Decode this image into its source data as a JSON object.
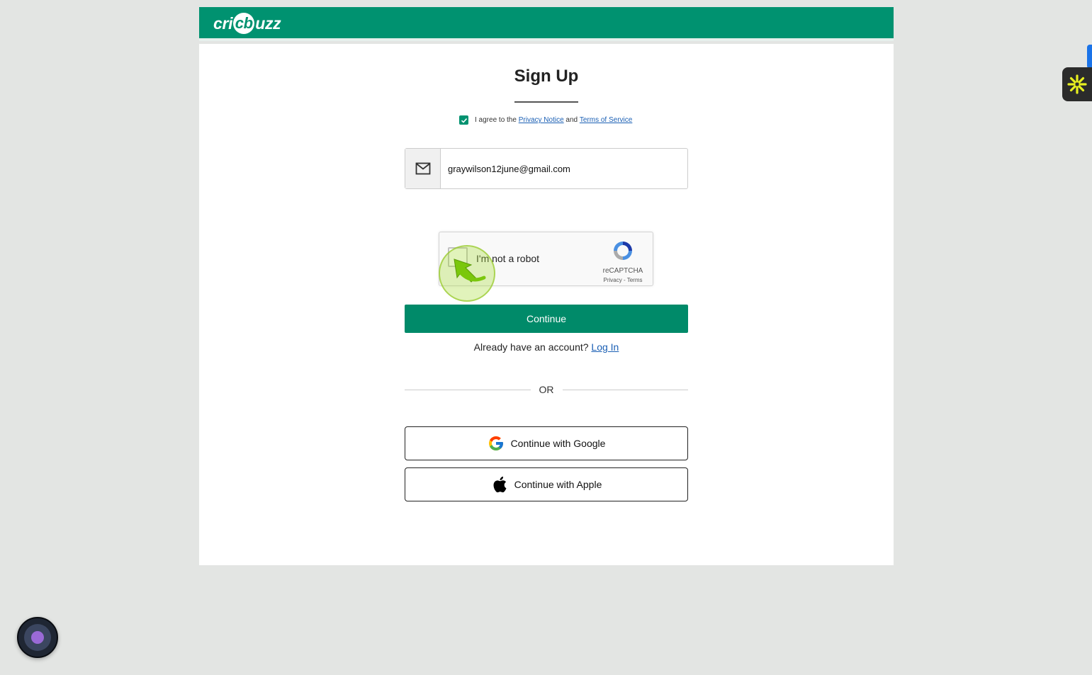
{
  "header": {
    "logo_text_left": "cri",
    "logo_text_ball": "cb",
    "logo_text_right": "uzz",
    "logo_icon": "cricbuzz-logo",
    "color": "#009270"
  },
  "signup": {
    "title": "Sign Up",
    "agree_prefix": "I agree to the",
    "privacy_link": "Privacy Notice",
    "agree_and": "and",
    "terms_link": "Terms of Service",
    "agree_checked": true,
    "email_value": "graywilson12june@gmail.com",
    "email_icon": "mail-icon",
    "recaptcha": {
      "label": "I'm not a robot",
      "brand": "reCAPTCHA",
      "links": "Privacy - Terms",
      "checked": false
    },
    "continue_label": "Continue",
    "login_prompt": "Already have an account?",
    "login_link": "Log In",
    "or_text": "OR",
    "google_label": "Continue with Google",
    "apple_label": "Continue with Apple"
  },
  "colors": {
    "brand_green": "#009270",
    "link_blue": "#1a5fb4",
    "page_bg": "#e3e5e3"
  }
}
